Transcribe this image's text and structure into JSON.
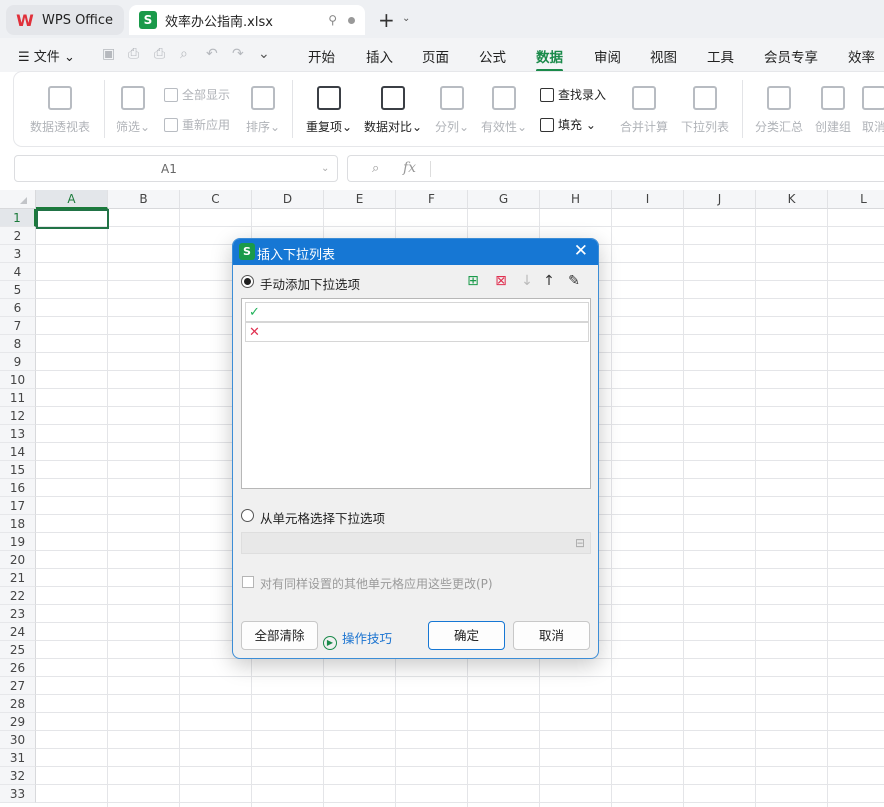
{
  "tabs": {
    "wps": "WPS Office",
    "file": "效率办公指南.xlsx"
  },
  "menu": {
    "file_label": "文件",
    "tabs": [
      "开始",
      "插入",
      "页面",
      "公式",
      "数据",
      "审阅",
      "视图",
      "工具",
      "会员专享",
      "效率"
    ],
    "active_tab": "数据"
  },
  "ribbon": {
    "pivot": "数据透视表",
    "filter": "筛选",
    "show_all": "全部显示",
    "reapply": "重新应用",
    "sort": "排序",
    "duplicates": "重复项",
    "compare": "数据对比",
    "split": "分列",
    "validity": "有效性",
    "lookup_entry": "查找录入",
    "fill": "填充",
    "consolidate": "合并计算",
    "dropdown_list": "下拉列表",
    "subtotal": "分类汇总",
    "create_group": "创建组",
    "cancel": "取消"
  },
  "formula_bar": {
    "cell_ref": "A1",
    "fx": "fx",
    "value": ""
  },
  "grid": {
    "columns": [
      "A",
      "B",
      "C",
      "D",
      "E",
      "F",
      "G",
      "H",
      "I",
      "J",
      "K",
      "L"
    ],
    "rows": [
      "1",
      "2",
      "3",
      "4",
      "5",
      "6",
      "7",
      "8",
      "9",
      "10",
      "11",
      "12",
      "13",
      "14",
      "15",
      "16",
      "17",
      "18",
      "19",
      "20",
      "21",
      "22",
      "23",
      "24",
      "25",
      "26",
      "27",
      "28",
      "29",
      "30",
      "31",
      "32",
      "33"
    ],
    "selected_cell": "A1"
  },
  "dialog": {
    "title": "插入下拉列表",
    "manual_option": "手动添加下拉选项",
    "items": [
      {
        "icon": "check-icon",
        "color": "#21b25a",
        "glyph": "✓"
      },
      {
        "icon": "cross-icon",
        "color": "#e03050",
        "glyph": "✕"
      }
    ],
    "cell_option": "从单元格选择下拉选项",
    "apply_same": "对有同样设置的其他单元格应用这些更改(P)",
    "clear_all": "全部清除",
    "tips": "操作技巧",
    "ok": "确定",
    "cancel": "取消"
  }
}
